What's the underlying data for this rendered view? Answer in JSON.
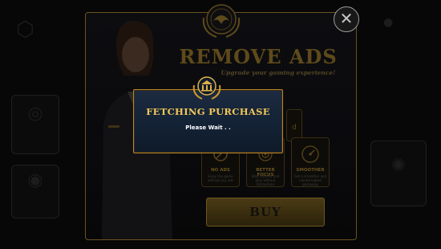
{
  "popup": {
    "title": "REMOVE ADS",
    "subtitle": "Upgrade your gaming experience!",
    "close_symbol": "✕",
    "buy_label": "BUY",
    "features": [
      {
        "name": "NO ADS",
        "desc": "Enjoy the game without any ads",
        "icon": "no-ads-icon"
      },
      {
        "name": "BETTER FOCUS",
        "desc": "Stay focused and play without distractions",
        "icon": "focus-icon"
      },
      {
        "name": "SMOOTHER",
        "desc": "Get a smoother and uninterrupted gameplay",
        "icon": "speedometer-icon"
      }
    ]
  },
  "dialog": {
    "title": "FETCHING PURCHASE",
    "message": "Please Wait . ."
  },
  "colors": {
    "gold": "#f1c75a",
    "dialog_bg": "#132235",
    "dialog_border": "#b8862c"
  }
}
